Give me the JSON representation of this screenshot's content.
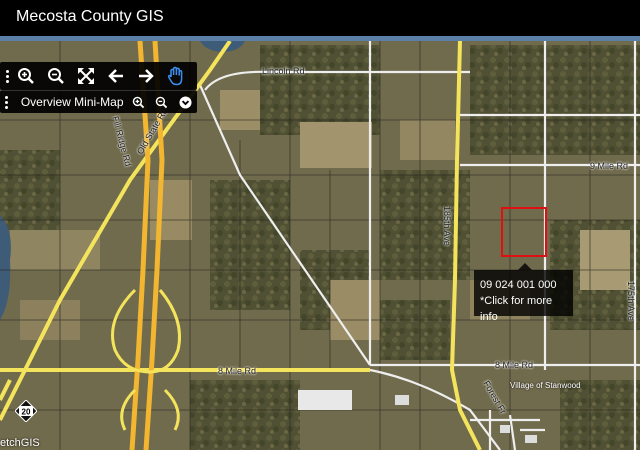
{
  "app": {
    "title": "Mecosta County GIS"
  },
  "toolbar": {
    "tools": [
      {
        "name": "zoom-in-icon"
      },
      {
        "name": "zoom-out-icon"
      },
      {
        "name": "full-extent-icon"
      },
      {
        "name": "back-arrow-icon"
      },
      {
        "name": "forward-arrow-icon"
      },
      {
        "name": "pan-hand-icon",
        "active": true
      }
    ]
  },
  "minimap": {
    "label": "Overview Mini-Map"
  },
  "tooltip": {
    "parcel_id": "09 024 001 000",
    "hint": "*Click for more info"
  },
  "roads": {
    "lincoln": "Lincoln Rd",
    "old_state": "Old State Rd",
    "avenue_185": "185th Ave",
    "mile_9": "9 Mile Rd",
    "mile_8_left": "8 Mile Rd",
    "mile_8_right": "8 Mile Rd",
    "forest": "Forest Fr",
    "ave_175": "175th Ave",
    "fill_ridge": "Fill Ridge Rd",
    "village": "Village of Stanwood"
  },
  "route_shield": "20",
  "attribution": "etchGIS",
  "colors": {
    "highway": "#f2b631",
    "road_yellow": "#f4e45c",
    "parcel": "#e01010",
    "land": "#6f6a4c"
  }
}
